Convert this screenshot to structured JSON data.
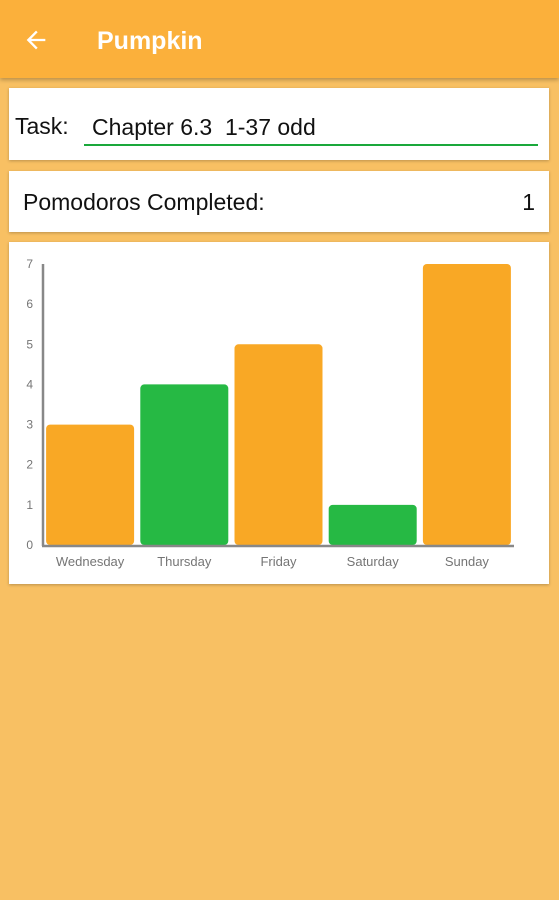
{
  "app_bar": {
    "title": "Pumpkin",
    "back_icon": "arrow-left-icon",
    "background": "#fbb03b"
  },
  "task": {
    "label": "Task:",
    "value": "Chapter 6.3  1-37 odd",
    "underline_color": "#1aa83b"
  },
  "pomodoros": {
    "label": "Pomodoros Completed:",
    "count": "1"
  },
  "chart_data": {
    "type": "bar",
    "categories": [
      "Wednesday",
      "Thursday",
      "Friday",
      "Saturday",
      "Sunday"
    ],
    "values": [
      3,
      4,
      5,
      1,
      7
    ],
    "colors": [
      "#f9a825",
      "#26b944",
      "#f9a825",
      "#26b944",
      "#f9a825"
    ],
    "ylim": [
      0,
      7
    ],
    "yticks": [
      "0",
      "1",
      "2",
      "3",
      "4",
      "5",
      "6",
      "7"
    ],
    "title": "",
    "xlabel": "",
    "ylabel": "",
    "grid": false
  },
  "colors": {
    "page_background": "#f8c063",
    "orange": "#f9a825",
    "green": "#26b944"
  }
}
